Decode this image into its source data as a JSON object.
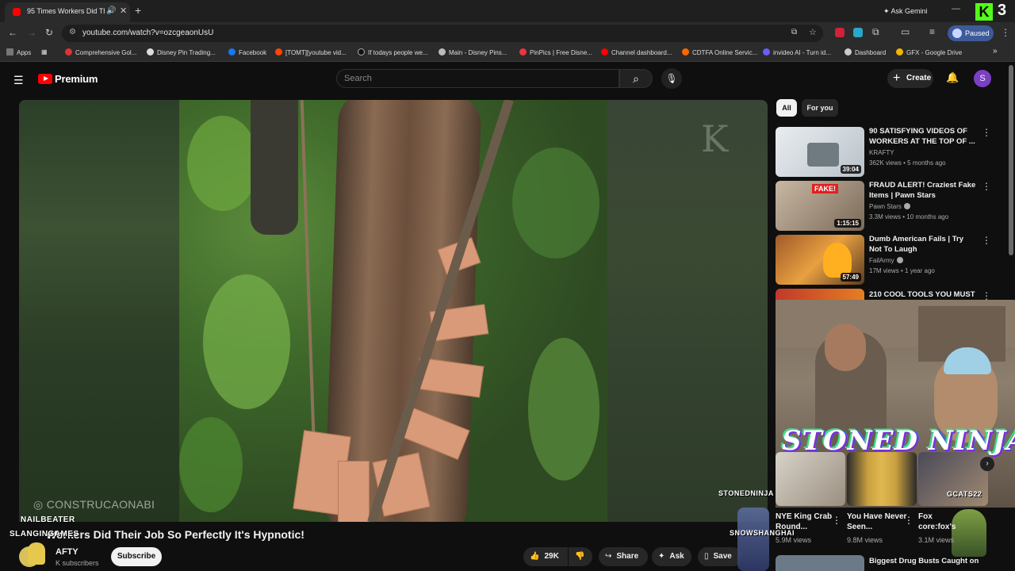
{
  "browser": {
    "tab_title": "95 Times Workers Did Their Job So Perfectly",
    "new_tab_symbol": "+",
    "ask_gemini": "Ask Gemini",
    "url": "youtube.com/watch?v=ozcgeaonUsU",
    "profile_status": "Paused",
    "kick_badge": "K",
    "kick_number": "3",
    "bookmarks": [
      "Apps",
      "Comprehensive Gol...",
      "Disney Pin Trading...",
      "Facebook",
      "[TOMT][youtube vid...",
      "If todays people we...",
      "Main - Disney Pins...",
      "PinPics | Free Disne...",
      "Channel dashboard...",
      "CDTFA Online Servic...",
      "invideo AI - Turn id...",
      "Dashboard",
      "GFX - Google Drive"
    ]
  },
  "youtube": {
    "brand": "Premium",
    "search_placeholder": "Search",
    "create_label": "Create",
    "avatar_letter": "S",
    "chips": [
      "All",
      "For you"
    ],
    "accent": "#ff0000"
  },
  "video": {
    "watermark_text": "CONSTRUCAONABI",
    "watermark_logo": "K",
    "title": "95 Times Workers Did Their Job So Perfectly It's Hypnotic!",
    "title_visible": "Workers Did Their Job So Perfectly It's Hypnotic!",
    "channel": "AFTY",
    "subscribers": "K subscribers",
    "subscribe_label": "Subscribe",
    "likes": "29K",
    "share_label": "Share",
    "ask_label": "Ask",
    "save_label": "Save"
  },
  "overlay": {
    "name1": "NAILBEATER",
    "name2": "SLANGINGAMES",
    "stream_title": "STONED NINJA",
    "shelf_names": [
      "STONEDNINJA",
      "GCATS22",
      "SNOWSHANGHAI"
    ]
  },
  "recommendations": [
    {
      "title": "90 SATISFYING VIDEOS OF WORKERS AT THE TOP OF ...",
      "channel": "KRAFTY",
      "meta": "362K views • 5 months ago",
      "duration": "39:04",
      "verified": false
    },
    {
      "title": "FRAUD ALERT! Craziest Fake Items | Pawn Stars",
      "channel": "Pawn Stars",
      "meta": "3.3M views • 10 months ago",
      "duration": "1:15:15",
      "verified": true
    },
    {
      "title": "Dumb American Fails | Try Not To Laugh",
      "channel": "FailArmy",
      "meta": "17M views • 1 year ago",
      "duration": "57:49",
      "verified": true
    },
    {
      "title": "210 COOL TOOLS YOU MUST",
      "channel": "",
      "meta": "",
      "duration": "",
      "verified": false
    }
  ],
  "shorts": [
    {
      "title": "NYE King Crab Round...",
      "views": "5.9M views"
    },
    {
      "title": "You Have Never Seen...",
      "views": "9.8M views"
    },
    {
      "title": "Fox core:fox's",
      "views": "3.1M views"
    }
  ],
  "last_rec_title": "Biggest Drug Busts Caught on"
}
